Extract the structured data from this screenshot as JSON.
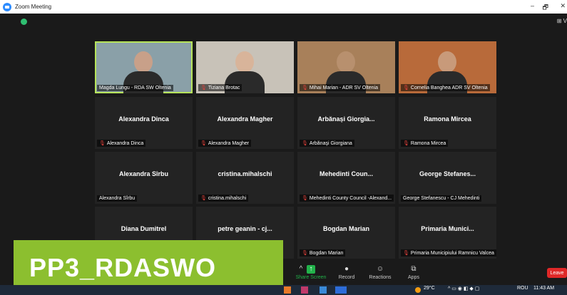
{
  "window": {
    "title": "Zoom Meeting",
    "minimize": "–",
    "maximize": "🗗"
  },
  "view": {
    "label": "⊞ V"
  },
  "participants": [
    {
      "big": "",
      "name": "Magda Lungu - RDA SW Oltenia",
      "muted": false,
      "video": true,
      "active": true
    },
    {
      "big": "",
      "name": "Tiziana Brotac",
      "muted": true,
      "video": true
    },
    {
      "big": "",
      "name": "Mihai Marian - ADR SV Oltenia",
      "muted": true,
      "video": true
    },
    {
      "big": "",
      "name": "Cornelia Banghea ADR SV Oltenia",
      "muted": true,
      "video": true
    },
    {
      "big": "Alexandra Dinca",
      "name": "Alexandra Dinca",
      "muted": true
    },
    {
      "big": "Alexandra Magher",
      "name": "Alexandra Magher",
      "muted": true
    },
    {
      "big": "Arbănași Giorgia...",
      "name": "Arbănaşi Giorgiana",
      "muted": true
    },
    {
      "big": "Ramona Mircea",
      "name": "Ramona Mircea",
      "muted": true
    },
    {
      "big": "Alexandra Sîrbu",
      "name": "Alexandra Sîrbu",
      "muted": false
    },
    {
      "big": "cristina.mihalschi",
      "name": "cristina.mihalschi",
      "muted": true
    },
    {
      "big": "Mehedinti Coun...",
      "name": "Mehedinti County Council -Alexand...",
      "muted": true
    },
    {
      "big": "George Stefanes...",
      "name": "George Stefanescu - CJ Mehedinti",
      "muted": false
    },
    {
      "big": "Diana Dumitrel",
      "name": "",
      "muted": false
    },
    {
      "big": "petre geanin - cj...",
      "name": "",
      "muted": false
    },
    {
      "big": "Bogdan Marian",
      "name": "Bogdan Marian",
      "muted": true
    },
    {
      "big": "Primaria Munici...",
      "name": "Primaria Municipiului Ramnicu Valcea",
      "muted": true
    }
  ],
  "banner": {
    "text": "PP3_RDASWO"
  },
  "toolbar": {
    "share_screen": "Share Screen",
    "record": "Record",
    "reactions": "Reactions",
    "apps": "Apps",
    "leave": "Leave"
  },
  "taskbar": {
    "temperature": "29°C",
    "language": "ROU",
    "time": "11:43 AM"
  },
  "colors": {
    "accent_green": "#8cbf2f",
    "active_border": "#b6e35a",
    "leave_red": "#e02828",
    "share_green": "#22b34a"
  }
}
